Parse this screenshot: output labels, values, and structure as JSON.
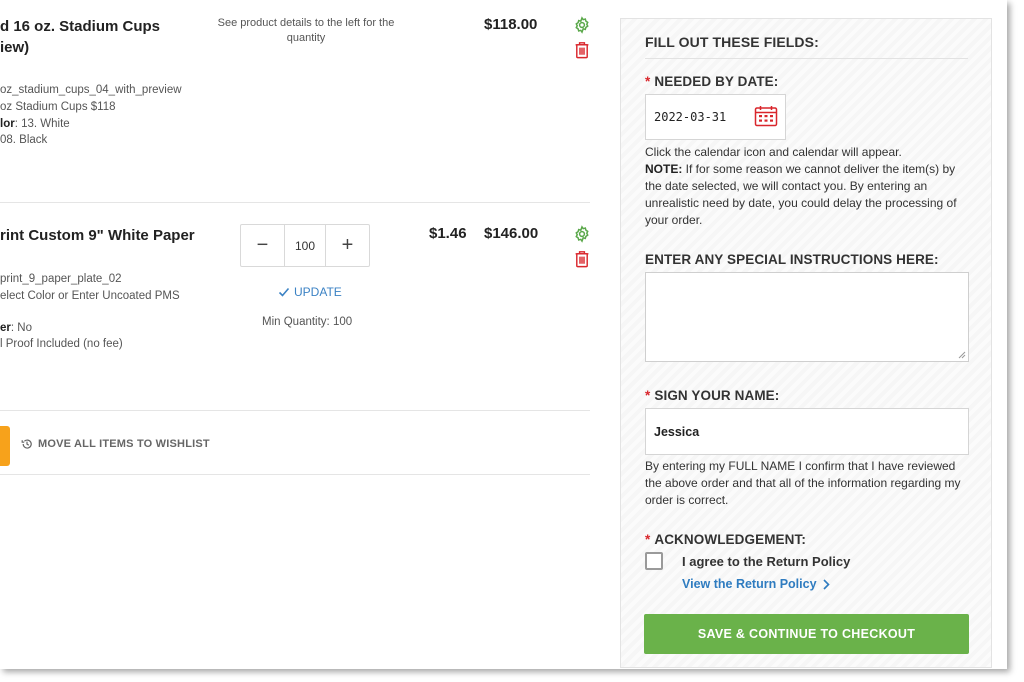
{
  "cart": {
    "items": [
      {
        "title_line1": "d 16 oz. Stadium Cups",
        "title_line2": "iew)",
        "sku": "oz_stadium_cups_04_with_preview",
        "meta2": "oz Stadium Cups $118",
        "meta3_label": "lor",
        "meta3_value": ": 13. White",
        "meta4": "08. Black",
        "note": "See product details to the left for the quantity",
        "total": "$118.00"
      },
      {
        "title_line1": "rint Custom 9\" White Paper",
        "sku": "print_9_paper_plate_02",
        "meta2": "elect Color or Enter Uncoated PMS",
        "meta3_label": "er",
        "meta3_value": ": No",
        "meta4": "l Proof Included (no fee)",
        "quantity": "100",
        "update_label": "UPDATE",
        "min_quantity": "Min Quantity: 100",
        "unit_price": "$1.46",
        "total": "$146.00"
      }
    ],
    "wishlist_label": "MOVE ALL ITEMS TO WISHLIST"
  },
  "form": {
    "heading": "FILL OUT THESE FIELDS:",
    "needed_by": {
      "label": "NEEDED BY DATE:",
      "value": "2022-03-31",
      "help_line1": "Click the calendar icon and calendar will appear.",
      "note_label": "NOTE:",
      "note_text": " If for some reason we cannot deliver the item(s) by the date selected, we will contact you. By entering an unrealistic need by date, you could delay the processing of your order."
    },
    "special_instructions": {
      "label": "ENTER ANY SPECIAL INSTRUCTIONS HERE:",
      "value": ""
    },
    "signature": {
      "label": "SIGN YOUR NAME:",
      "value": "Jessica",
      "help": "By entering my FULL NAME I confirm that I have reviewed the above order and that all of the information regarding my order is correct."
    },
    "acknowledgement": {
      "label": "ACKNOWLEDGEMENT:",
      "checkbox_label": "I agree to the Return Policy",
      "link": "View the Return Policy"
    },
    "submit_label": "SAVE & CONTINUE TO CHECKOUT",
    "required_mark": "*"
  },
  "colors": {
    "accent_green": "#6ab24a",
    "icon_green": "#5aa84a",
    "icon_red": "#d9262c",
    "link_blue": "#2f7cc0",
    "orange": "#f7a21b"
  }
}
